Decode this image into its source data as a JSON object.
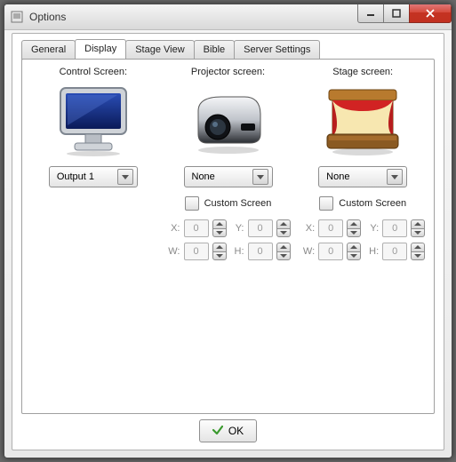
{
  "window": {
    "title": "Options"
  },
  "tabs": {
    "general": "General",
    "display": "Display",
    "stage_view": "Stage View",
    "bible": "Bible",
    "server_settings": "Server Settings",
    "active": "display"
  },
  "columns": {
    "control": {
      "title": "Control Screen:",
      "dropdown": "Output 1",
      "has_custom_screen": false
    },
    "projector": {
      "title": "Projector screen:",
      "dropdown": "None",
      "custom_label": "Custom Screen",
      "x_label": "X:",
      "x": "0",
      "y_label": "Y:",
      "y": "0",
      "w_label": "W:",
      "w": "0",
      "h_label": "H:",
      "h": "0"
    },
    "stage": {
      "title": "Stage screen:",
      "dropdown": "None",
      "custom_label": "Custom Screen",
      "x_label": "X:",
      "x": "0",
      "y_label": "Y:",
      "y": "0",
      "w_label": "W:",
      "w": "0",
      "h_label": "H:",
      "h": "0"
    }
  },
  "footer": {
    "ok": "OK"
  }
}
